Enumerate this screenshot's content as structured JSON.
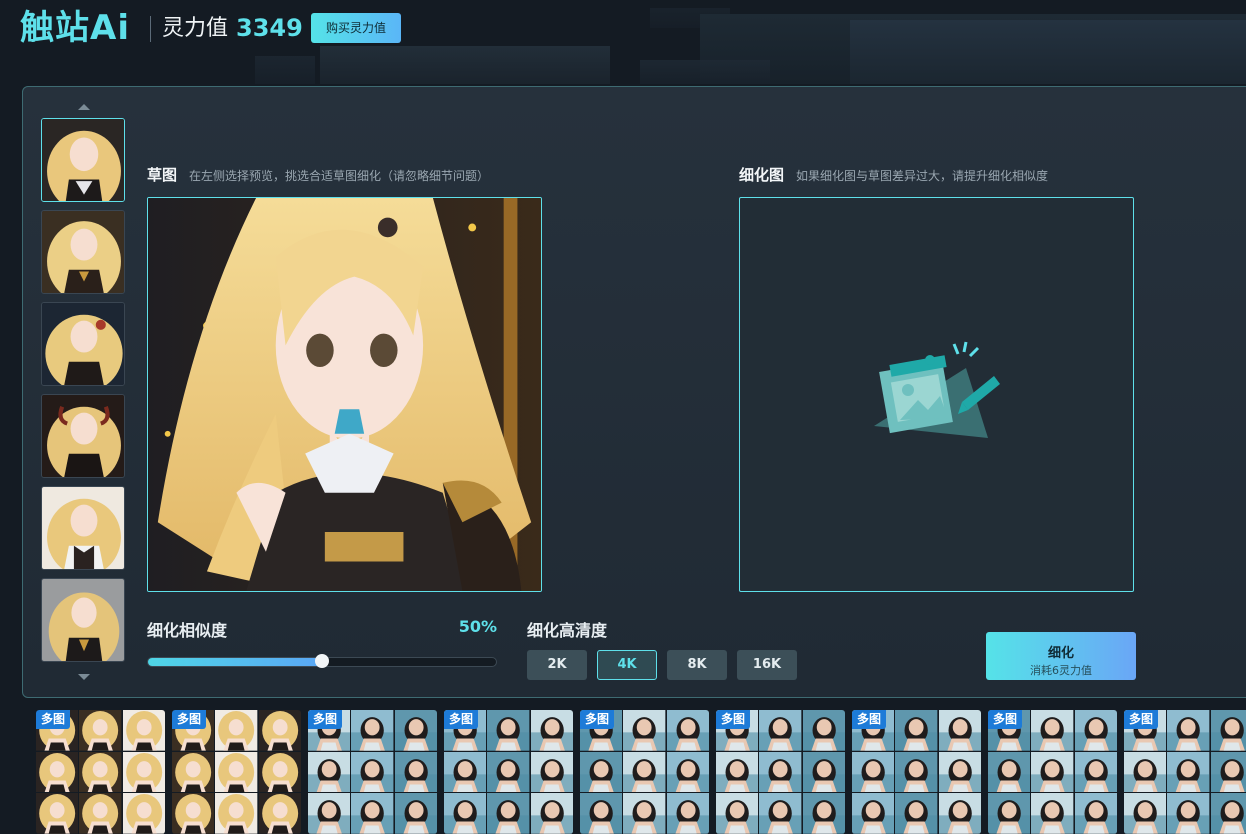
{
  "header": {
    "logo": "触站Ai",
    "points_label": "灵力值",
    "points_value": "3349",
    "buy_button": "购买灵力值"
  },
  "sketch": {
    "title": "草图",
    "hint": "在左侧选择预览，挑选合适草图细化（请忽略细节问题）"
  },
  "refine": {
    "title": "细化图",
    "hint": "如果细化图与草图差异过大，请提升细化相似度"
  },
  "similarity": {
    "label": "细化相似度",
    "value_text": "50%",
    "value": 0.5
  },
  "resolution": {
    "label": "细化高清度",
    "options": [
      "2K",
      "4K",
      "8K",
      "16K"
    ],
    "selected": "4K"
  },
  "refine_button": {
    "label": "细化",
    "cost": "消耗6灵力值"
  },
  "strip": {
    "badge": "多图",
    "items": [
      "anime",
      "anime",
      "beach",
      "beach",
      "beach",
      "beach",
      "beach",
      "beach",
      "beach"
    ]
  },
  "colors": {
    "accent": "#5ee0ea",
    "badge": "#1d7bd8",
    "button_gradient_start": "#55e3e8",
    "button_gradient_end": "#6aa6f6"
  }
}
